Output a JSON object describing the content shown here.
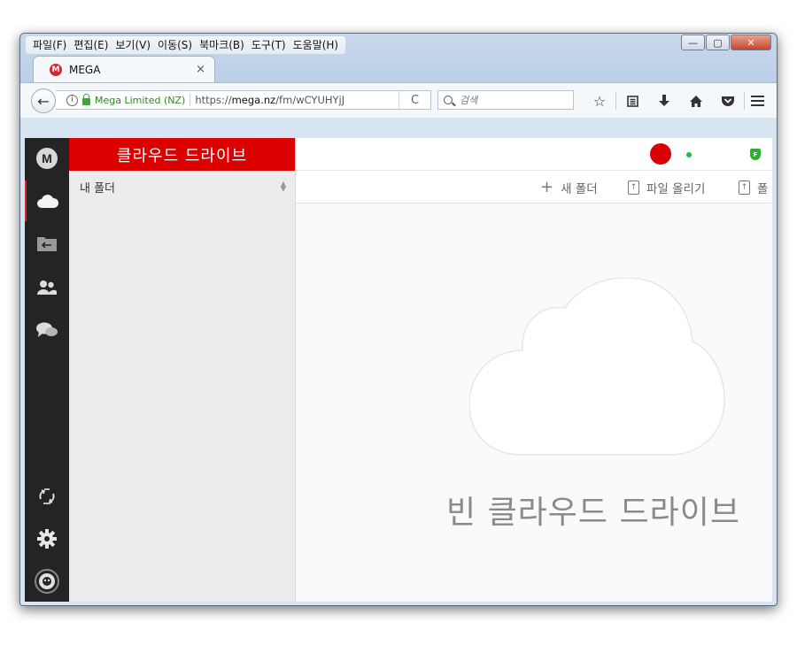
{
  "browser": {
    "menu": [
      "파일(F)",
      "편집(E)",
      "보기(V)",
      "이동(S)",
      "북마크(B)",
      "도구(T)",
      "도움말(H)"
    ],
    "window_controls": {
      "minimize": "—",
      "maximize": "▢",
      "close": "✕"
    },
    "tab": {
      "favicon": "M",
      "title": "MEGA",
      "close": "×"
    },
    "urlbar": {
      "site_identity": "Mega Limited (NZ)",
      "url_prefix": "https://",
      "url_domain": "mega.nz",
      "url_path": "/fm/wCYUHYjJ",
      "reload": "C"
    },
    "search": {
      "placeholder": "검색"
    },
    "toolbar_icons": [
      "star-icon",
      "reading-list-icon",
      "download-icon",
      "home-icon",
      "pocket-icon",
      "menu-icon"
    ]
  },
  "app": {
    "rail": {
      "logo": "M",
      "items": [
        "cloud-drive-icon",
        "inbox-icon",
        "contacts-icon",
        "chat-icon"
      ],
      "bottom": [
        "rubbish-bin-icon",
        "settings-icon",
        "account-icon"
      ]
    },
    "panel": {
      "header": "클라우드 드라이브",
      "tree_item": "내 폴더"
    },
    "actions": {
      "new_folder": "새 폴더",
      "upload_file": "파일 올리기",
      "upload_folder": "폴"
    },
    "pro_badge": "F",
    "empty_text": "빈 클라우드 드라이브"
  },
  "colors": {
    "mega_red": "#dd0000",
    "rail_bg": "#242424",
    "online": "#13c24a"
  }
}
